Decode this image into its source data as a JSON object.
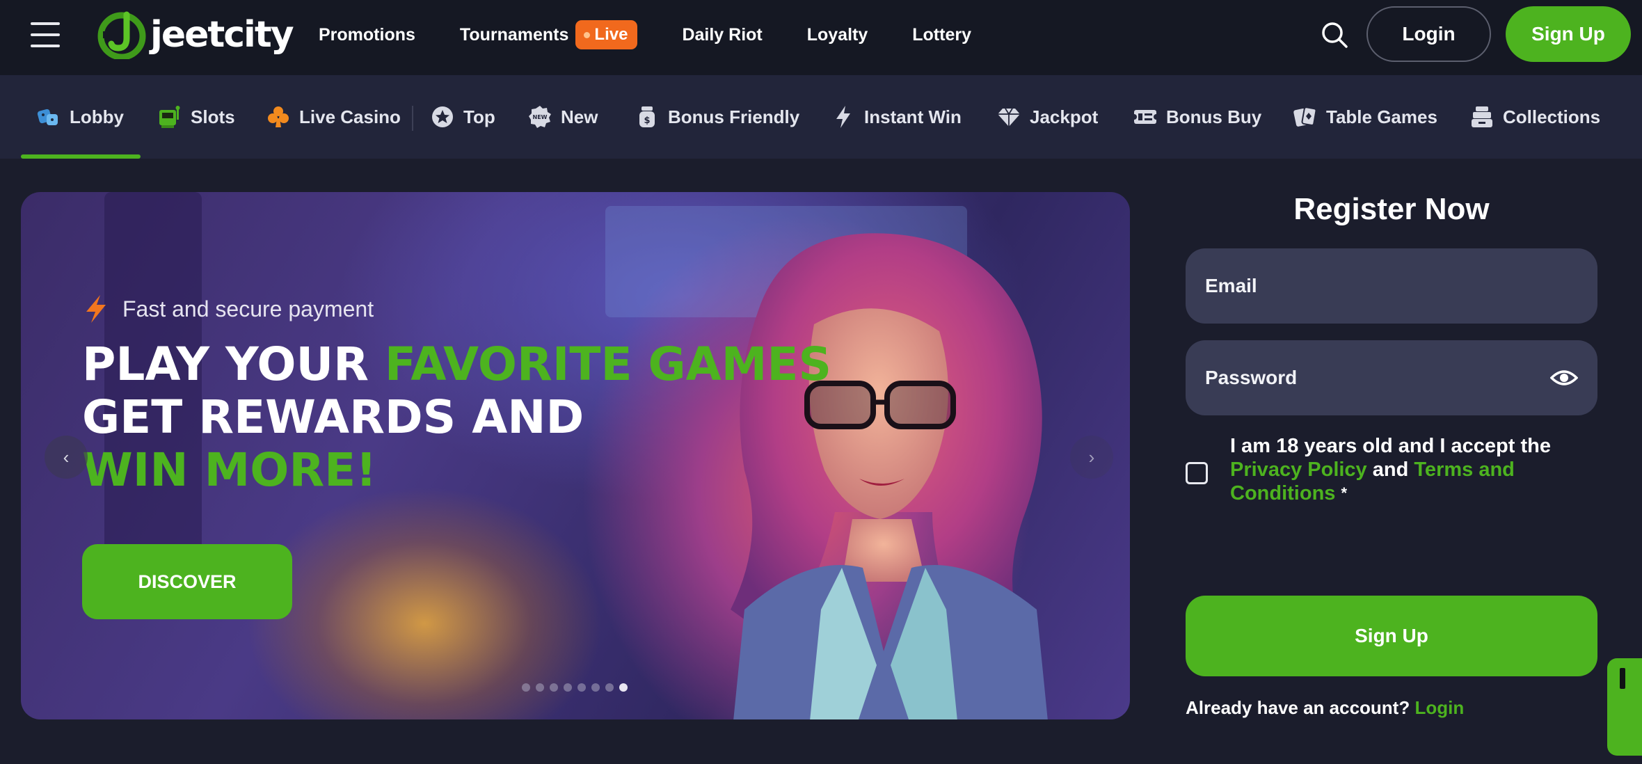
{
  "header": {
    "brand": "jeetcity",
    "nav": [
      {
        "label": "Promotions"
      },
      {
        "label": "Tournaments",
        "badge": "Live"
      },
      {
        "label": "Daily Riot"
      },
      {
        "label": "Loyalty"
      },
      {
        "label": "Lottery"
      }
    ],
    "login_label": "Login",
    "signup_label": "Sign Up"
  },
  "categories": [
    {
      "label": "Lobby",
      "icon": "dice-icon",
      "active": true
    },
    {
      "label": "Slots",
      "icon": "slot-machine-icon"
    },
    {
      "label": "Live Casino",
      "icon": "club-icon"
    },
    {
      "label": "Top",
      "icon": "star-icon"
    },
    {
      "label": "New",
      "icon": "new-badge-icon"
    },
    {
      "label": "Bonus Friendly",
      "icon": "money-jar-icon"
    },
    {
      "label": "Instant Win",
      "icon": "lightning-icon"
    },
    {
      "label": "Jackpot",
      "icon": "diamond-icon"
    },
    {
      "label": "Bonus Buy",
      "icon": "ticket-icon"
    },
    {
      "label": "Table Games",
      "icon": "cards-icon"
    },
    {
      "label": "Collections",
      "icon": "stack-icon"
    }
  ],
  "hero": {
    "tagline": "Fast and secure payment",
    "title_white_1": "PLAY YOUR ",
    "title_green_1": "FAVORITE GAMES",
    "title_white_2": "GET REWARDS AND",
    "title_green_2": "WIN MORE!",
    "cta": "DISCOVER",
    "prev": "‹",
    "next": "›",
    "slide_count": 8,
    "active_slide": 8
  },
  "register": {
    "title": "Register Now",
    "email_placeholder": "Email",
    "password_placeholder": "Password",
    "terms_prefix": "I am 18 years old and I accept the",
    "privacy_link": "Privacy Policy",
    "and": "and",
    "terms_link": "Terms and Conditions",
    "required_mark": "*",
    "signup_label": "Sign Up",
    "have_account": "Already have an account?",
    "login_link": "Login"
  },
  "colors": {
    "accent": "#4db31f",
    "live_badge": "#f1691d",
    "header_bg": "#151823",
    "category_bg": "#22253a",
    "page_bg": "#1b1d2c",
    "field_bg": "#393c55"
  }
}
